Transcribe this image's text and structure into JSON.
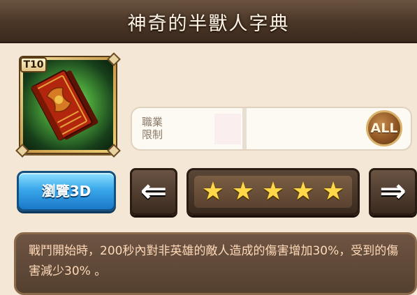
{
  "title": "神奇的半獸人字典",
  "item": {
    "tier": "T10",
    "icon": "red-book-icon"
  },
  "job": {
    "label": "職業限制",
    "badge": "ALL"
  },
  "buttons": {
    "browse_3d": "瀏覽3D",
    "prev": "⇐",
    "next": "⇒"
  },
  "stars": {
    "count": 5,
    "max": 5,
    "symbol": "★"
  },
  "description": "戰鬥開始時，200秒內對非英雄的敵人造成的傷害增加30%，受到的傷害減少30% 。",
  "colors": {
    "title_bar": "#4a3626",
    "button_blue": "#3aa8ea",
    "star": "#ffd84a",
    "desc_text": "#ffd9b8"
  }
}
